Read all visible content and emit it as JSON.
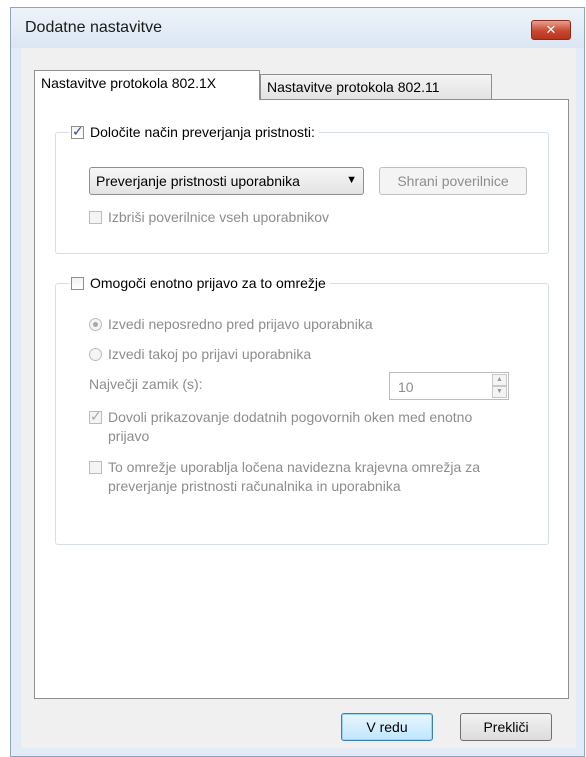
{
  "window": {
    "title": "Dodatne nastavitve",
    "close_glyph": "✕"
  },
  "tabs": [
    {
      "label": "Nastavitve protokola 802.1X",
      "active": true
    },
    {
      "label": "Nastavitve protokola 802.11",
      "active": false
    }
  ],
  "auth_group": {
    "label": "Določite način preverjanja pristnosti:",
    "checked": true,
    "mode_value": "Preverjanje pristnosti uporabnika",
    "save_credentials_label": "Shrani poverilnice",
    "delete_credentials_label": "Izbriši poverilnice vseh uporabnikov"
  },
  "sso_group": {
    "label": "Omogoči enotno prijavo za to omrežje",
    "checked": false,
    "radio_before": "Izvedi neposredno pred prijavo uporabnika",
    "radio_after": "Izvedi takoj po prijavi uporabnika",
    "max_delay_label": "Največji zamik (s):",
    "max_delay_value": "10",
    "allow_dialogs_label": "Dovoli prikazovanje dodatnih pogovornih oken med enotno prijavo",
    "separate_vlan_label": "To omrežje uporablja ločena navidezna krajevna omrežja za preverjanje pristnosti računalnika in uporabnika"
  },
  "footer": {
    "ok_label": "V redu",
    "cancel_label": "Prekliči"
  }
}
